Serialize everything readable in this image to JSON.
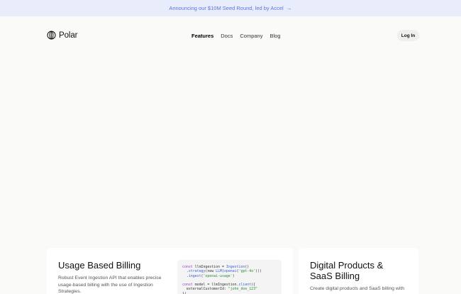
{
  "banner": {
    "text": "Announcing our $10M Seed Round, led by Accel",
    "arrow": "→"
  },
  "nav": {
    "brand": "Polar",
    "links": [
      "Features",
      "Docs",
      "Company",
      "Blog"
    ],
    "active_link": "Features",
    "login_label": "Log In"
  },
  "cards": [
    {
      "title": "Usage Based Billing",
      "description": "Robust Event Ingestion API that enables precise usage-based billing with the use of Ingestion Strategies."
    },
    {
      "title": "Digital Products & SaaS Billing",
      "description": "Create digital products and SaaS billing with"
    }
  ],
  "code": {
    "line1_kw": "const",
    "line1_rest": " llmIngestion = ",
    "line1_fn": "Ingestion",
    "line1_end": "()",
    "line2_pre": "  .",
    "line2_fn": "strategy",
    "line2_mid": "(new ",
    "line2_fn2": "LLM",
    "line2_mid2": "(",
    "line2_fn3": "openai",
    "line2_mid3": "(",
    "line2_str": "'gpt-4o'",
    "line2_end": ")))",
    "line3_pre": "  .",
    "line3_fn": "ingest",
    "line3_mid": "(",
    "line3_str": "'openai-usage'",
    "line3_end": ")",
    "line5_kw": "const",
    "line5_rest": " model = llmIngestion.",
    "line5_fn": "client",
    "line5_end": "({",
    "line6_pre": "  externalCustomerId: ",
    "line6_str": "\"john_doe_123\"",
    "line7": "})"
  }
}
